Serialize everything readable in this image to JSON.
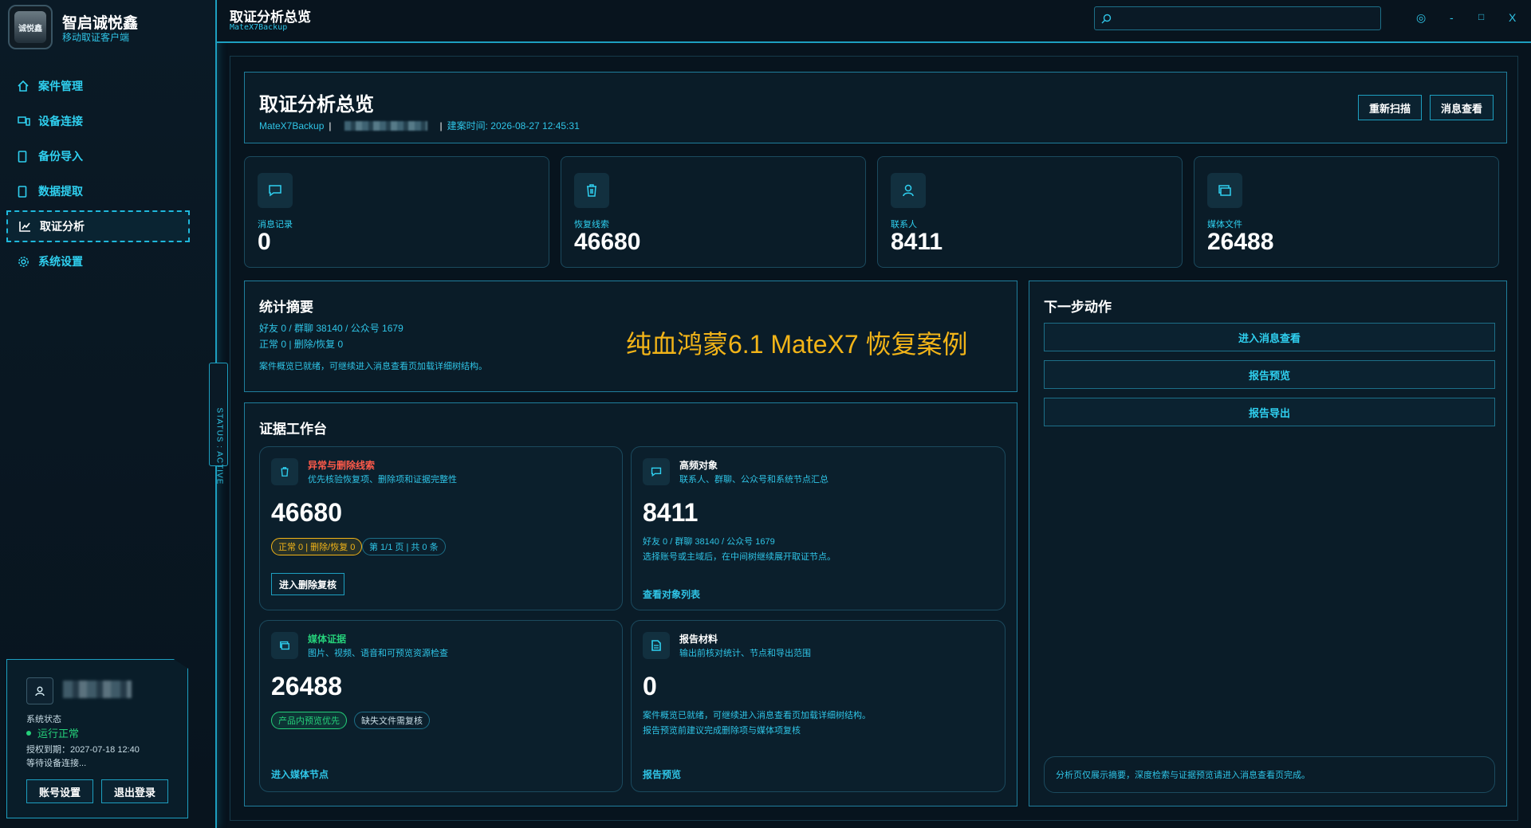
{
  "app": {
    "title": "智启诚悦鑫",
    "subtitle": "移动取证客户端",
    "logo_text": "诚悦鑫"
  },
  "nav": {
    "items": [
      {
        "label": "案件管理",
        "icon": "home-icon"
      },
      {
        "label": "设备连接",
        "icon": "device-icon"
      },
      {
        "label": "备份导入",
        "icon": "phone-icon"
      },
      {
        "label": "数据提取",
        "icon": "phone-icon"
      },
      {
        "label": "取证分析",
        "icon": "chart-icon",
        "active": true
      },
      {
        "label": "系统设置",
        "icon": "gear-icon"
      }
    ]
  },
  "status_tab": "STATUS : ACTIVE",
  "user_card": {
    "status_label": "系统状态",
    "status_value": "运行正常",
    "expire": "授权到期：2027-07-18 12:40",
    "waiting": "等待设备连接...",
    "account_button": "账号设置",
    "logout_button": "退出登录"
  },
  "topbar": {
    "title": "取证分析总览",
    "subtitle": "MateX7Backup",
    "search_placeholder": "",
    "controls": {
      "theme": "◎",
      "minimize": "-",
      "maximize": "□",
      "close": "X"
    }
  },
  "header": {
    "title": "取证分析总览",
    "case_name": "MateX7Backup",
    "created": "建案时间: 2026-08-27 12:45:31",
    "rescan_button": "重新扫描",
    "view_messages_button": "消息查看"
  },
  "stats": [
    {
      "label": "消息记录",
      "value": "0",
      "icon": "message-icon"
    },
    {
      "label": "恢复线索",
      "value": "46680",
      "icon": "trash-icon"
    },
    {
      "label": "联系人",
      "value": "8411",
      "icon": "user-icon"
    },
    {
      "label": "媒体文件",
      "value": "26488",
      "icon": "media-icon"
    }
  ],
  "summary": {
    "title": "统计摘要",
    "line1": "好友 0 / 群聊 38140 / 公众号 1679",
    "line2": "正常 0 | 删除/恢复 0",
    "line3": "案件概览已就绪，可继续进入消息查看页加载详细树结构。",
    "watermark": "纯血鸿蒙6.1 MateX7 恢复案例"
  },
  "next_actions": {
    "title": "下一步动作",
    "buttons": [
      "进入消息查看",
      "报告预览",
      "报告导出"
    ],
    "footer": "分析页仅展示摘要，深度检索与证据预览请进入消息查看页完成。"
  },
  "workbench": {
    "title": "证据工作台",
    "cards": [
      {
        "title": "异常与删除线索",
        "title_color": "#ff5a4a",
        "desc": "优先核验恢复项、删除项和证据完整性",
        "value": "46680",
        "tags": [
          "正常 0 | 删除/恢复 0",
          "第 1/1 页 | 共 0 条"
        ],
        "button": "进入删除复核",
        "icon": "trash-icon"
      },
      {
        "title": "高频对象",
        "title_color": "#ffffff",
        "desc": "联系人、群聊、公众号和系统节点汇总",
        "value": "8411",
        "line1": "好友 0 / 群聊 38140 / 公众号 1679",
        "line2": "选择账号或主域后，在中间树继续展开取证节点。",
        "link": "查看对象列表",
        "icon": "message-icon"
      },
      {
        "title": "媒体证据",
        "title_color": "#25d07a",
        "desc": "图片、视频、语音和可预览资源检查",
        "value": "26488",
        "tags": [
          "产品内预览优先",
          "缺失文件需复核"
        ],
        "link": "进入媒体节点",
        "icon": "media-icon"
      },
      {
        "title": "报告材料",
        "title_color": "#ffffff",
        "desc": "输出前核对统计、节点和导出范围",
        "value": "0",
        "line1": "案件概览已就绪，可继续进入消息查看页加载详细树结构。",
        "line2": "报告预览前建议完成删除项与媒体项复核",
        "link": "报告预览",
        "icon": "document-icon"
      }
    ]
  },
  "colors": {
    "accent": "#1d9fc0",
    "cyan_text": "#2fc4e6",
    "background": "#07131d",
    "warning": "#f2b418",
    "success": "#25d07a",
    "danger": "#ff5a4a"
  }
}
